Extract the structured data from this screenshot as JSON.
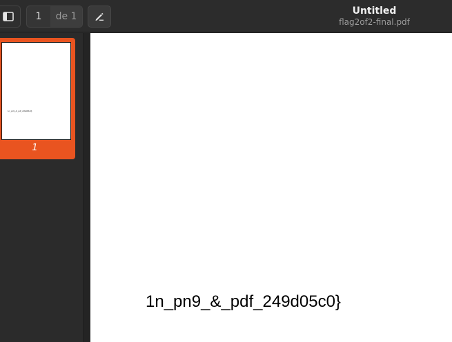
{
  "header": {
    "title": "Untitled",
    "subtitle": "flag2of2-final.pdf",
    "page_current": "1",
    "page_total": "de 1",
    "icons": {
      "sidebar_toggle": "sidebar-icon",
      "annotate": "pen-annotate-icon"
    }
  },
  "sidebar": {
    "thumbnails": [
      {
        "label": "1",
        "preview_text": "1n_pn9_&_pdf_249d05c0}"
      }
    ],
    "accent_color": "#e95420"
  },
  "document": {
    "text": "1n_pn9_&_pdf_249d05c0}"
  }
}
